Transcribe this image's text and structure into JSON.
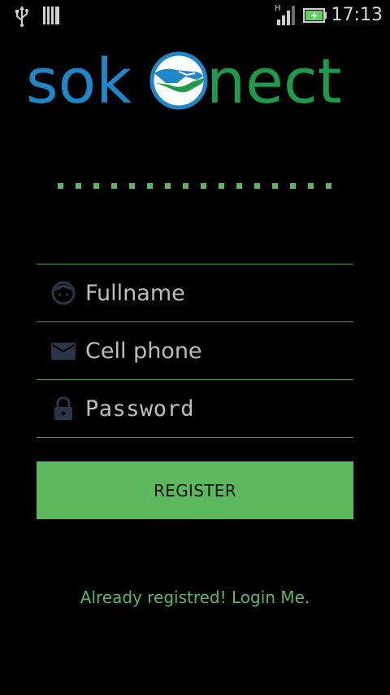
{
  "status_bar": {
    "time": "17:13",
    "network_type": "H",
    "icons": [
      "usb-icon",
      "sd-card-icon",
      "signal-icon",
      "battery-charging-icon"
    ]
  },
  "logo": {
    "text_left": "sok",
    "text_right": "nect",
    "icon": "handshake-icon"
  },
  "progress_dots": {
    "count": 16
  },
  "form": {
    "fullname": {
      "placeholder": "Fullname",
      "icon": "face-icon",
      "value": ""
    },
    "cell_phone": {
      "placeholder": "Cell phone",
      "icon": "mail-icon",
      "value": ""
    },
    "password": {
      "placeholder": "Password",
      "icon": "lock-icon",
      "value": ""
    }
  },
  "register_button": {
    "label": "REGISTER"
  },
  "login_link": {
    "label": "Already registred! Login Me."
  },
  "colors": {
    "accent_green": "#5cb85c",
    "logo_blue": "#1f86c8",
    "logo_green": "#1e9b4a",
    "background": "#000000",
    "icon_gray": "#2c3546"
  }
}
